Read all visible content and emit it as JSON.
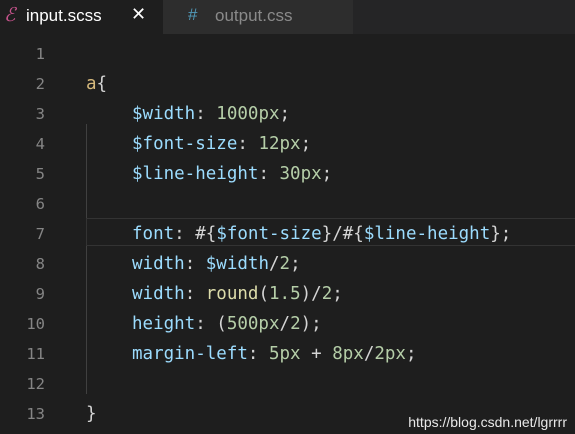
{
  "tabs": [
    {
      "label": "input.scss",
      "icon": "sass-icon",
      "close": "✕",
      "active": true
    },
    {
      "label": "output.css",
      "icon": "hash-icon",
      "active": false
    }
  ],
  "editor": {
    "line_numbers": [
      "1",
      "2",
      "3",
      "4",
      "5",
      "6",
      "7",
      "8",
      "9",
      "10",
      "11",
      "12",
      "13"
    ],
    "lines": [
      {
        "tokens": []
      },
      {
        "tokens": [
          {
            "t": "a",
            "c": "sel"
          },
          {
            "t": "{",
            "c": "punc"
          }
        ]
      },
      {
        "tokens": [
          {
            "t": "$width",
            "c": "var"
          },
          {
            "t": ": ",
            "c": "punc"
          },
          {
            "t": "1000px",
            "c": "num"
          },
          {
            "t": ";",
            "c": "punc"
          }
        ]
      },
      {
        "tokens": [
          {
            "t": "$font-size",
            "c": "var"
          },
          {
            "t": ": ",
            "c": "punc"
          },
          {
            "t": "12px",
            "c": "num"
          },
          {
            "t": ";",
            "c": "punc"
          }
        ]
      },
      {
        "tokens": [
          {
            "t": "$line-height",
            "c": "var"
          },
          {
            "t": ": ",
            "c": "punc"
          },
          {
            "t": "30px",
            "c": "num"
          },
          {
            "t": ";",
            "c": "punc"
          }
        ]
      },
      {
        "tokens": []
      },
      {
        "tokens": [
          {
            "t": "font",
            "c": "var"
          },
          {
            "t": ": #{",
            "c": "punc"
          },
          {
            "t": "$font-size",
            "c": "var"
          },
          {
            "t": "}/#{",
            "c": "punc"
          },
          {
            "t": "$line-height",
            "c": "var"
          },
          {
            "t": "};",
            "c": "punc"
          }
        ]
      },
      {
        "tokens": [
          {
            "t": "width",
            "c": "var"
          },
          {
            "t": ": ",
            "c": "punc"
          },
          {
            "t": "$width",
            "c": "var"
          },
          {
            "t": "/",
            "c": "punc"
          },
          {
            "t": "2",
            "c": "num"
          },
          {
            "t": ";",
            "c": "punc"
          }
        ]
      },
      {
        "tokens": [
          {
            "t": "width",
            "c": "var"
          },
          {
            "t": ": ",
            "c": "punc"
          },
          {
            "t": "round",
            "c": "fn"
          },
          {
            "t": "(",
            "c": "punc"
          },
          {
            "t": "1.5",
            "c": "num"
          },
          {
            "t": ")/",
            "c": "punc"
          },
          {
            "t": "2",
            "c": "num"
          },
          {
            "t": ";",
            "c": "punc"
          }
        ]
      },
      {
        "tokens": [
          {
            "t": "height",
            "c": "var"
          },
          {
            "t": ": (",
            "c": "punc"
          },
          {
            "t": "500px",
            "c": "num"
          },
          {
            "t": "/",
            "c": "punc"
          },
          {
            "t": "2",
            "c": "num"
          },
          {
            "t": ");",
            "c": "punc"
          }
        ]
      },
      {
        "tokens": [
          {
            "t": "margin-left",
            "c": "var"
          },
          {
            "t": ": ",
            "c": "punc"
          },
          {
            "t": "5px",
            "c": "num"
          },
          {
            "t": " + ",
            "c": "punc"
          },
          {
            "t": "8px",
            "c": "num"
          },
          {
            "t": "/",
            "c": "punc"
          },
          {
            "t": "2px",
            "c": "num"
          },
          {
            "t": ";",
            "c": "punc"
          }
        ]
      },
      {
        "tokens": []
      },
      {
        "tokens": [
          {
            "t": "}",
            "c": "punc"
          }
        ]
      }
    ]
  },
  "watermark": "https://blog.csdn.net/lgrrrr",
  "colors": {
    "background": "#1e1e1e",
    "tabbar": "#252526",
    "selector": "#d7ba7d",
    "property": "#9cdcfe",
    "number": "#b5cea8",
    "function": "#dcdcaa",
    "sass_icon": "#c6538c",
    "css_icon": "#519aba"
  }
}
